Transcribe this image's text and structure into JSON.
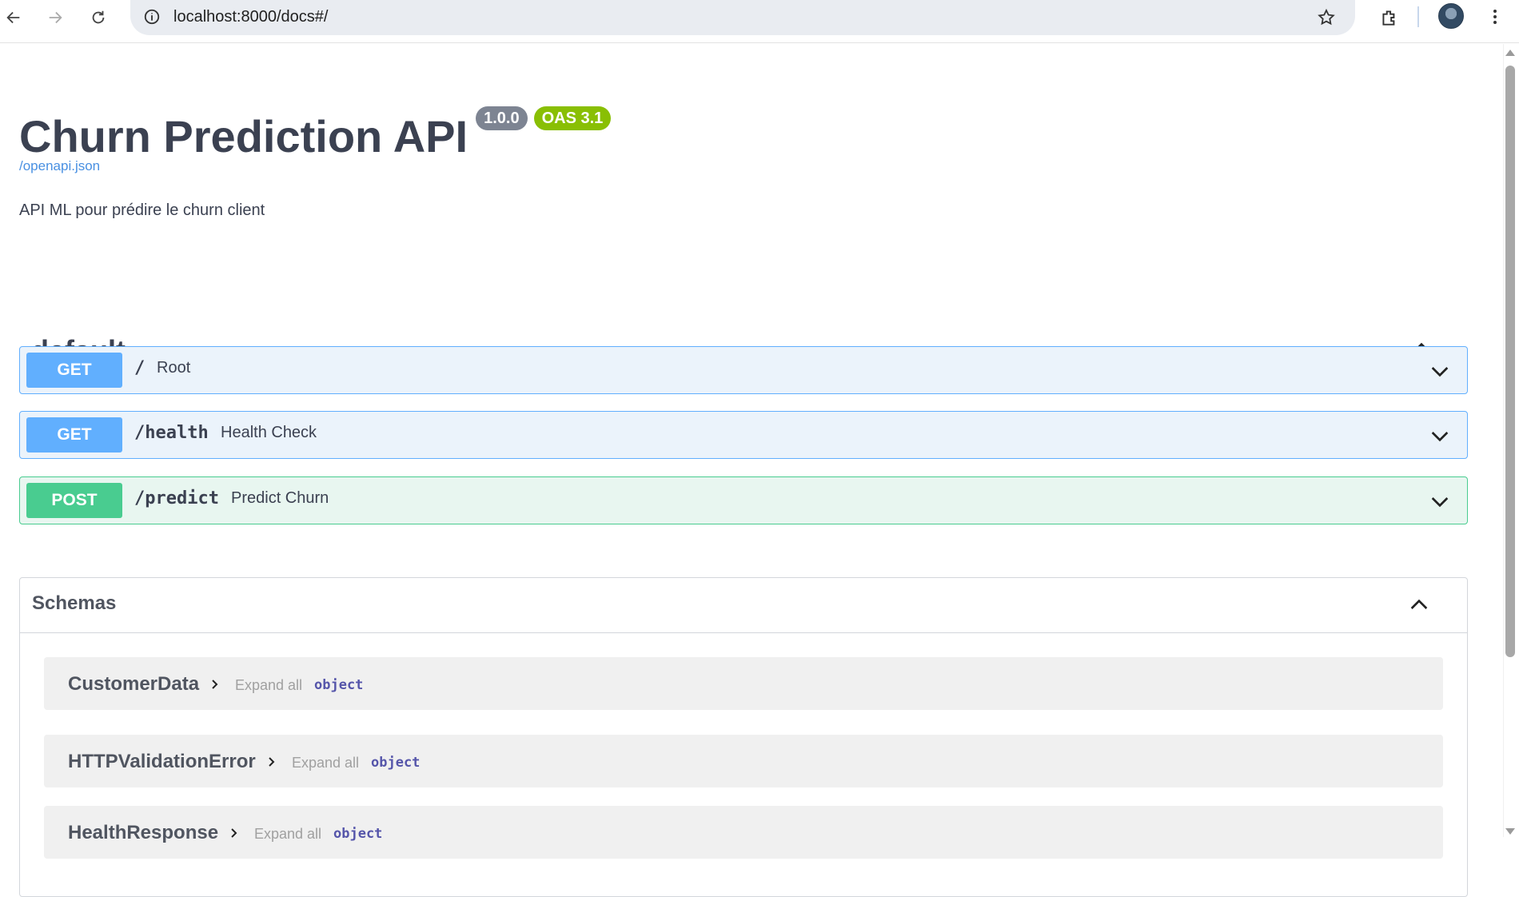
{
  "browser": {
    "url": "localhost:8000/docs#/"
  },
  "api": {
    "title": "Churn Prediction API",
    "version": "1.0.0",
    "oas": "OAS 3.1",
    "spec_link": "/openapi.json",
    "description": "API ML pour prédire le churn client"
  },
  "tag": {
    "name": "default"
  },
  "operations": [
    {
      "method": "GET",
      "path": "/",
      "summary": "Root"
    },
    {
      "method": "GET",
      "path": "/health",
      "summary": "Health Check"
    },
    {
      "method": "POST",
      "path": "/predict",
      "summary": "Predict Churn"
    }
  ],
  "schemas": {
    "title": "Schemas",
    "models": [
      {
        "name": "CustomerData",
        "expand": "Expand all",
        "type": "object"
      },
      {
        "name": "HTTPValidationError",
        "expand": "Expand all",
        "type": "object"
      },
      {
        "name": "HealthResponse",
        "expand": "Expand all",
        "type": "object"
      }
    ]
  },
  "colors": {
    "get": "#61affe",
    "post": "#49cc90",
    "version_badge": "#7d8492",
    "oas_badge": "#89bf04",
    "link": "#4990e2"
  },
  "icons": [
    "back-arrow-icon",
    "forward-arrow-icon",
    "reload-icon",
    "site-info-icon",
    "bookmark-star-icon",
    "extensions-icon",
    "kebab-menu-icon",
    "chevron-up-icon",
    "chevron-down-icon",
    "caret-right-icon"
  ]
}
